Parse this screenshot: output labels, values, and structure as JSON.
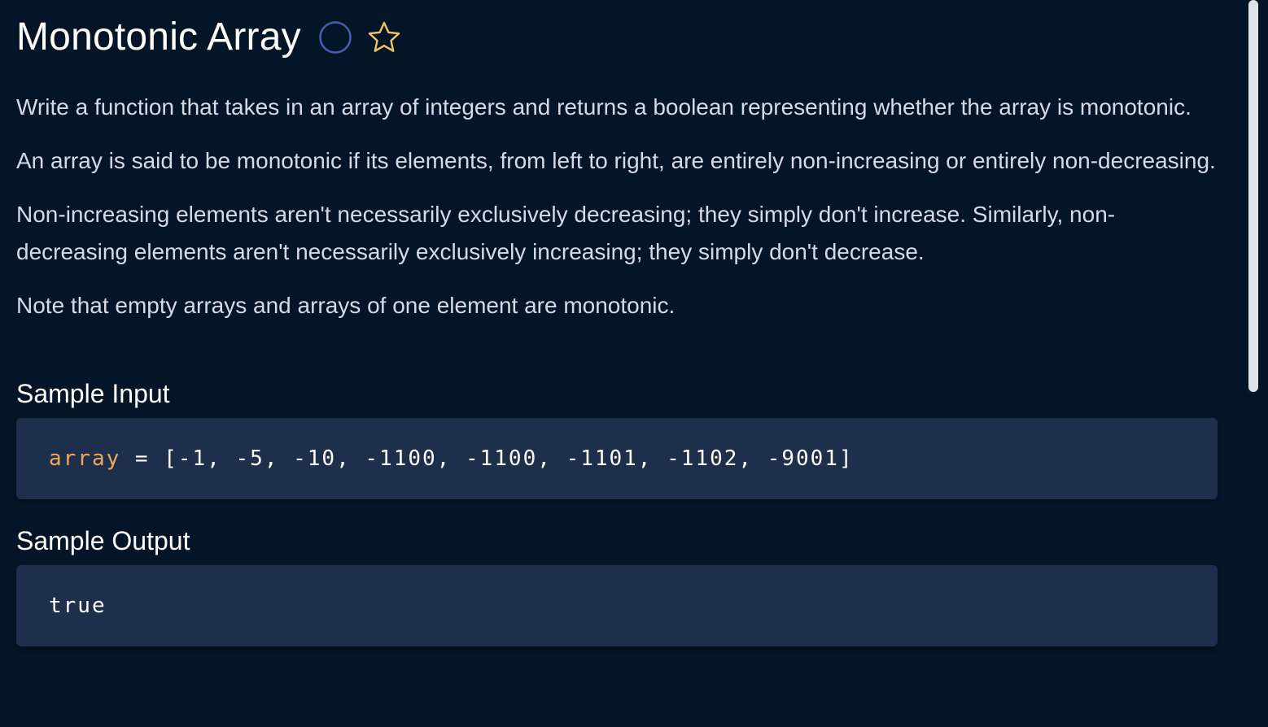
{
  "problem": {
    "title": "Monotonic Array",
    "status_icon": "empty-circle-icon",
    "favorite_icon": "star-outline-icon",
    "description": [
      "Write a function that takes in an array of integers and returns a boolean representing whether the array is monotonic.",
      "An array is said to be monotonic if its elements, from left to right, are entirely non-increasing or entirely non-decreasing.",
      "Non-increasing elements aren't necessarily exclusively decreasing; they simply don't increase. Similarly, non-decreasing elements aren't necessarily exclusively increasing; they simply don't decrease.",
      "Note that empty arrays and arrays of one element are monotonic."
    ]
  },
  "sample_input": {
    "heading": "Sample Input",
    "variable": "array",
    "operator": " = ",
    "value": "[-1, -5, -10, -1100, -1100, -1101, -1102, -9001]"
  },
  "sample_output": {
    "heading": "Sample Output",
    "value": "true"
  },
  "colors": {
    "background": "#041528",
    "code_background": "#1d2f4b",
    "variable": "#f5a65b",
    "star": "#f0c862",
    "circle": "#4a5bb5"
  }
}
